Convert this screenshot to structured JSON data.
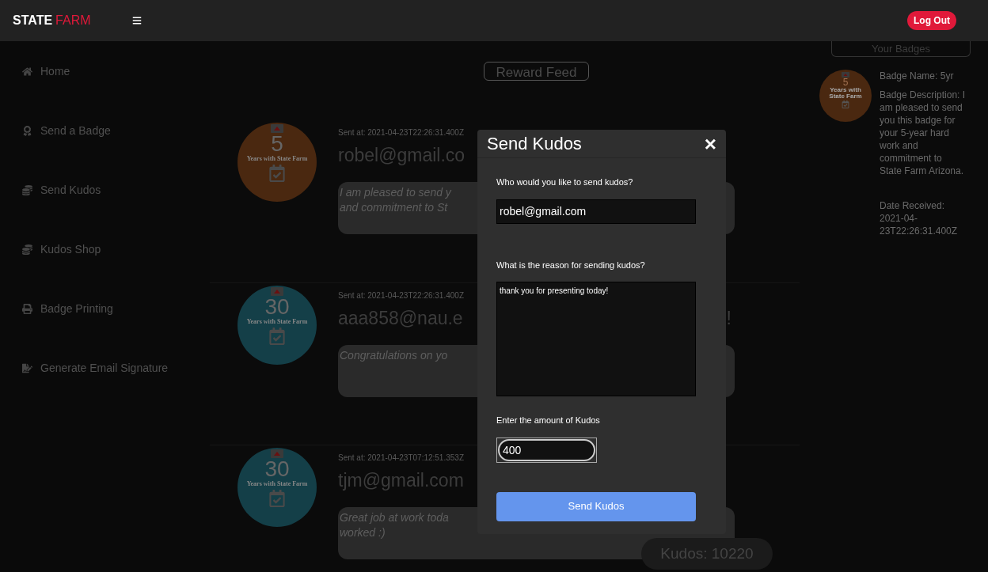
{
  "navbar": {
    "brand_first": "STATE",
    "brand_second": "FARM",
    "logout": "Log Out"
  },
  "sidebar": {
    "items": [
      {
        "label": "Home"
      },
      {
        "label": "Send a Badge"
      },
      {
        "label": "Send Kudos"
      },
      {
        "label": "Kudos Shop"
      },
      {
        "label": "Badge Printing"
      },
      {
        "label": "Generate Email Signature"
      }
    ]
  },
  "feed": {
    "title": "Reward Feed",
    "items": [
      {
        "badge": {
          "number": "5",
          "caption": "Years with State Farm",
          "color": "#4a2810"
        },
        "sent": "Sent at: 2021-04-23T22:26:31.400Z",
        "name": "robel@gmail.co",
        "message_lines": [
          "I am pleased to send y",
          "and commitment to St"
        ]
      },
      {
        "badge": {
          "number": "30",
          "caption": "Years with State Farm",
          "color": "#143f48"
        },
        "sent": "Sent at: 2021-04-23T22:26:31.400Z",
        "name": "aaa858@nau.e",
        "tail": "!",
        "message_lines": [
          "Congratulations on yo"
        ]
      },
      {
        "badge": {
          "number": "30",
          "caption": "Years with State Farm",
          "color": "#143f48"
        },
        "sent": "Sent at: 2021-04-23T07:12:51.353Z",
        "name": "tjm@gmail.com",
        "message_lines": [
          "Great job at work toda",
          "worked :)"
        ]
      }
    ]
  },
  "your_badges": {
    "title": "Your Badges",
    "badge": {
      "number": "5",
      "caption": "Years with State Farm",
      "color": "#4a2810"
    },
    "name": "Badge Name: 5yr",
    "description": "Badge Description: I am pleased to send you this badge for your 5-year hard work and commitment to State Farm Arizona.",
    "date": "Date Received: 2021-04-23T22:26:31.400Z"
  },
  "modal": {
    "title": "Send Kudos",
    "close": "×",
    "recipient_label": "Who would you like to send kudos?",
    "recipient": "robel@gmail.com",
    "reason_label": "What is the reason for sending kudos?",
    "reason": "thank you for presenting today!",
    "amount_label": "Enter the amount of Kudos",
    "amount": "400",
    "submit": "Send Kudos"
  },
  "kudos_balance": "Kudos: 10220"
}
